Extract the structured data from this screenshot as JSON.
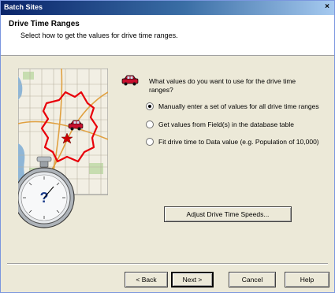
{
  "window": {
    "title": "Batch Sites",
    "close_glyph": "×"
  },
  "header": {
    "heading": "Drive Time Ranges",
    "subheading": "Select how to get the values for drive time ranges."
  },
  "question": "What values do you want to use for the drive time ranges?",
  "options": [
    {
      "label": "Manually enter a set of values for all drive time ranges",
      "checked": true
    },
    {
      "label": "Get values from Field(s) in the database table",
      "checked": false
    },
    {
      "label": "Fit drive time to Data value (e.g. Population of 10,000)",
      "checked": false
    }
  ],
  "adjust_button": "Adjust Drive Time Speeds...",
  "footer": {
    "back": "< Back",
    "next": "Next >",
    "cancel": "Cancel",
    "help": "Help"
  },
  "icons": {
    "map": "map-illustration-icon",
    "stopwatch": "stopwatch-icon",
    "car": "car-icon"
  },
  "colors": {
    "titlebar": "#0A246A",
    "face": "#ECE9D8",
    "boundary": "#E8000A"
  }
}
